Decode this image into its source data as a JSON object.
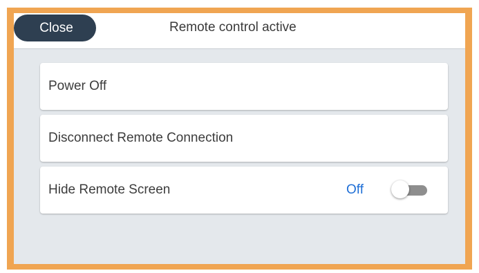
{
  "header": {
    "close_label": "Close",
    "title": "Remote control active"
  },
  "menu": {
    "items": [
      {
        "label": "Power Off"
      },
      {
        "label": "Disconnect Remote Connection"
      },
      {
        "label": "Hide Remote Screen",
        "state_label": "Off",
        "toggle_on": false
      }
    ]
  },
  "colors": {
    "frame": "#f0a552",
    "close_button_bg": "#2e3f51",
    "content_bg": "#e4e8ec",
    "toggle_state_text": "#1f6fd6",
    "toggle_track_off": "#8e8e8e"
  }
}
